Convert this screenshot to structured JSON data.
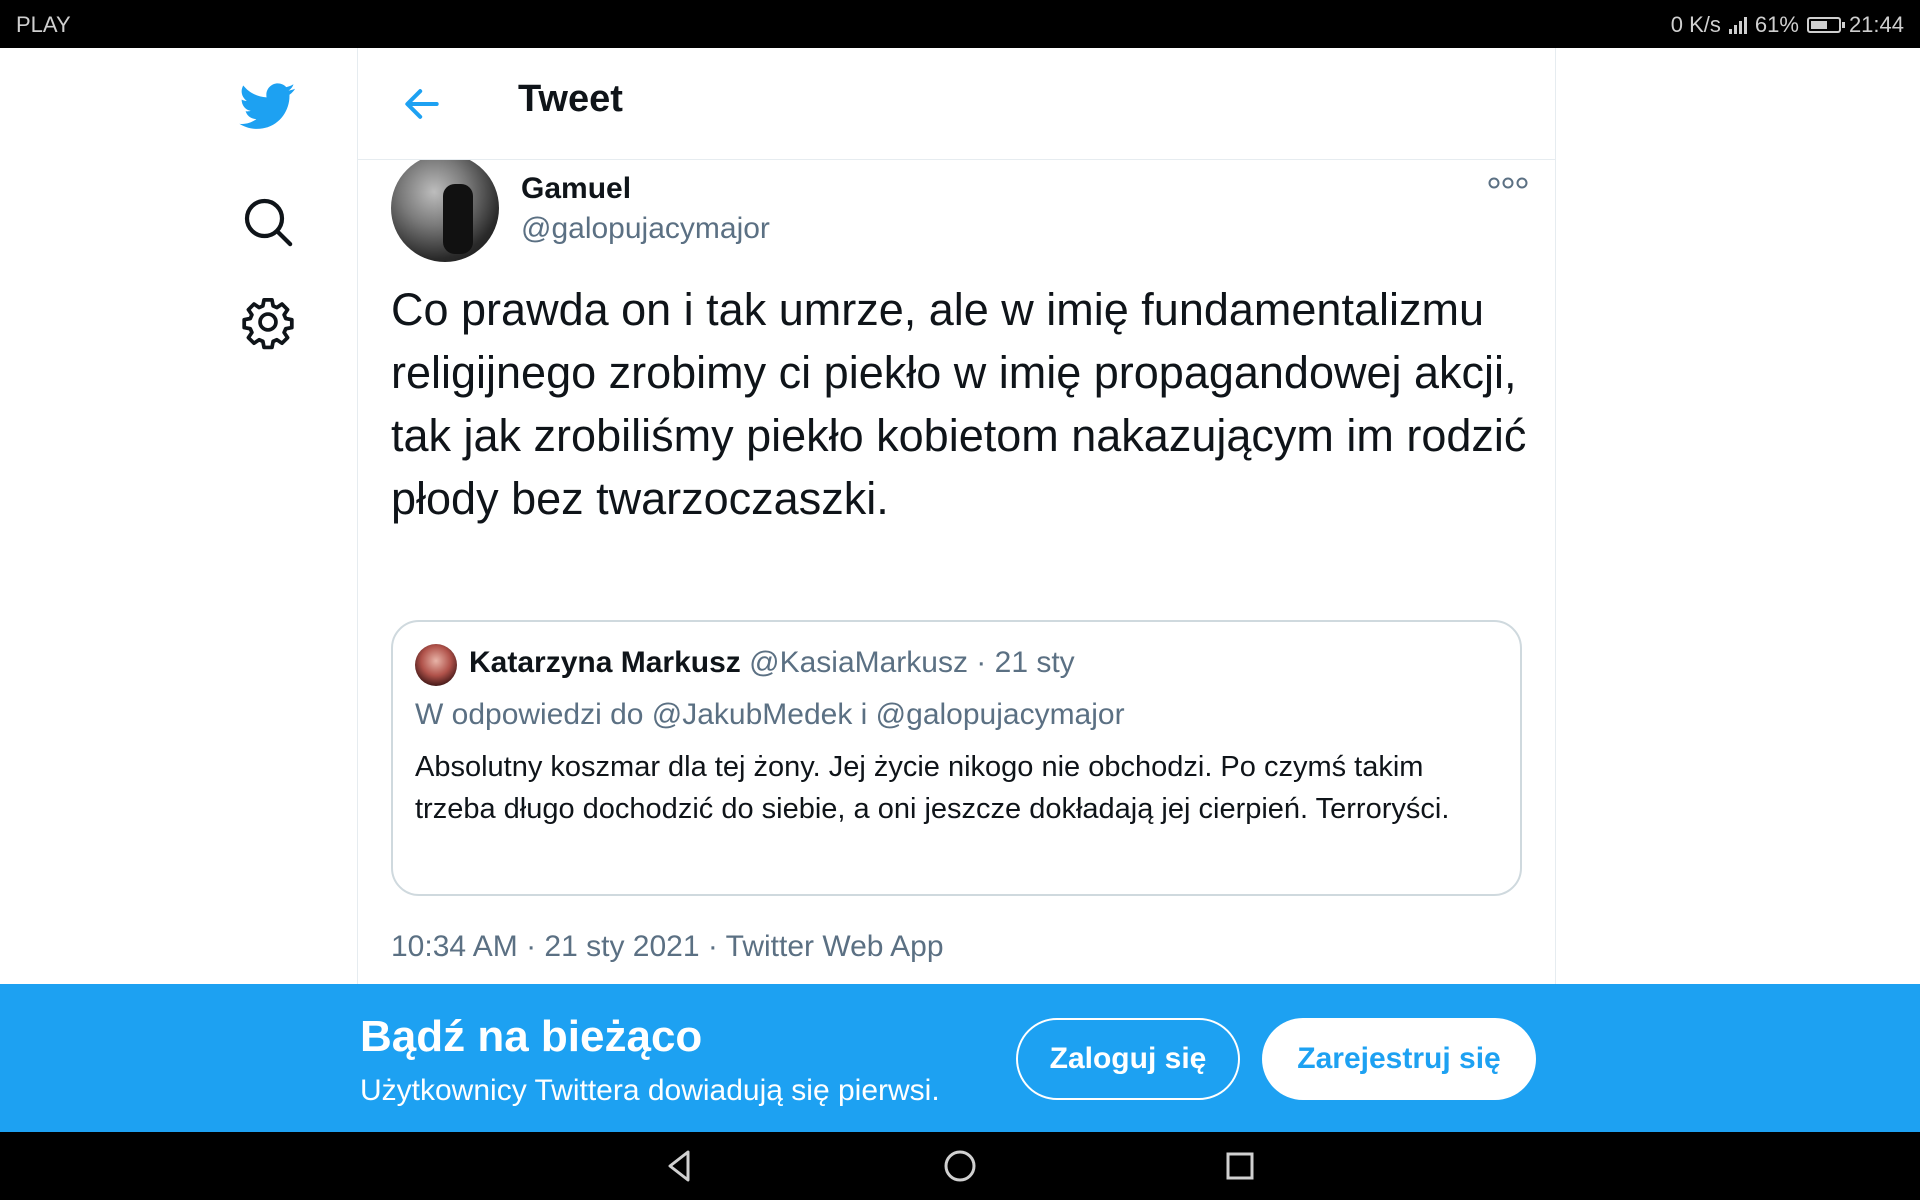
{
  "status_bar": {
    "carrier": "PLAY",
    "speed": "0 K/s",
    "battery_percent": "61%",
    "time": "21:44",
    "battery_level": 0.61
  },
  "nav": {
    "logo_icon": "twitter-bird-icon",
    "search_icon": "search-icon",
    "settings_icon": "gear-icon"
  },
  "header": {
    "title": "Tweet",
    "back_icon": "arrow-left-icon"
  },
  "tweet": {
    "author_name": "Gamuel",
    "author_handle": "@galopujacymajor",
    "text": "Co prawda on i tak umrze, ale w imię fundamentalizmu religijnego zrobimy ci piekło w imię propagandowej akcji, tak jak zrobiliśmy piekło kobietom nakazującym im rodzić płody bez twarzoczaszki.",
    "timestamp": "10:34 AM · 21 sty 2021 · Twitter Web App",
    "more_icon": "more-options-icon"
  },
  "quote": {
    "author_name": "Katarzyna Markusz",
    "author_meta": "@KasiaMarkusz · 21 sty",
    "reply_to": "W odpowiedzi do @JakubMedek i @galopujacymajor",
    "text": "Absolutny koszmar dla tej żony. Jej życie nikogo nie obchodzi. Po czymś takim trzeba długo dochodzić do siebie, a oni jeszcze dokładają jej cierpień. Terroryści."
  },
  "banner": {
    "title": "Bądź na bieżąco",
    "subtitle": "Użytkownicy Twittera dowiadują się pierwsi.",
    "login_label": "Zaloguj się",
    "signup_label": "Zarejestruj się"
  },
  "colors": {
    "brand_blue": "#1da1f2",
    "secondary_text": "#5b7083",
    "border": "#cfd9de"
  }
}
